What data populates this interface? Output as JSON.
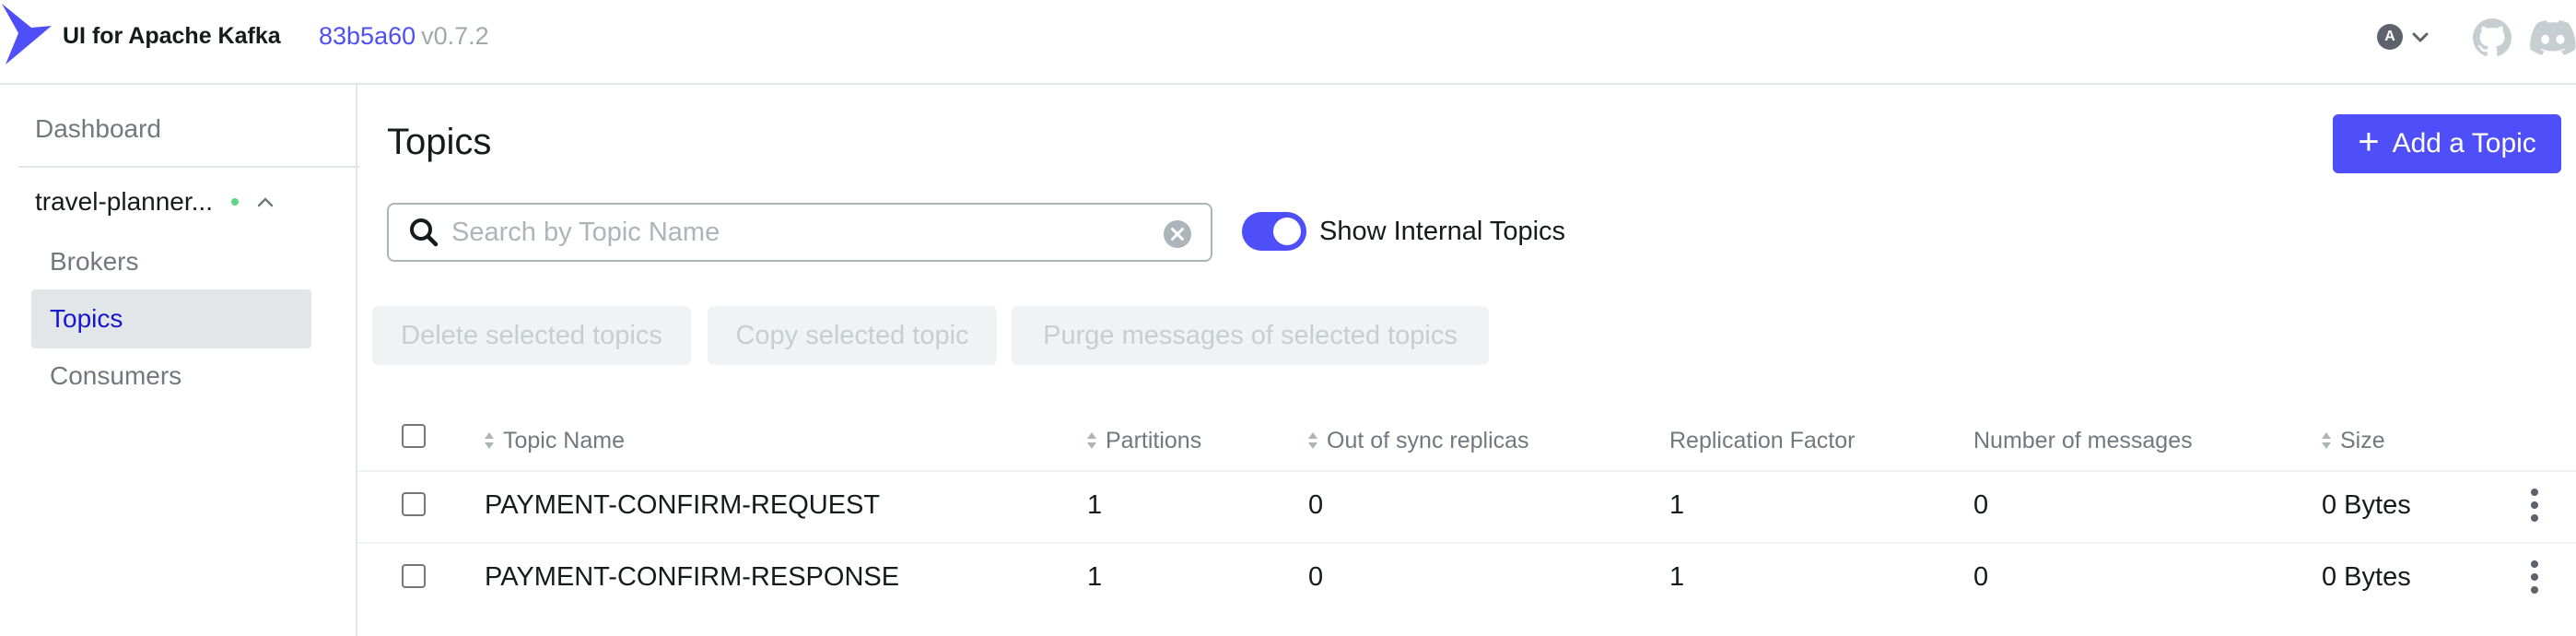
{
  "header": {
    "app_title": "UI for Apache Kafka",
    "version_hash": "83b5a60",
    "version_tag": "v0.7.2",
    "user_initial": "A"
  },
  "sidebar": {
    "dashboard": "Dashboard",
    "cluster_name": "travel-planner...",
    "items": [
      {
        "label": "Brokers",
        "active": false
      },
      {
        "label": "Topics",
        "active": true
      },
      {
        "label": "Consumers",
        "active": false
      }
    ]
  },
  "main": {
    "title": "Topics",
    "add_button": "Add a Topic",
    "search_placeholder": "Search by Topic Name",
    "toggle_label": "Show Internal Topics",
    "toggle_on": true,
    "batch_actions": [
      "Delete selected topics",
      "Copy selected topic",
      "Purge messages of selected topics"
    ]
  },
  "table": {
    "columns": [
      "Topic Name",
      "Partitions",
      "Out of sync replicas",
      "Replication Factor",
      "Number of messages",
      "Size"
    ],
    "rows": [
      {
        "name": "PAYMENT-CONFIRM-REQUEST",
        "partitions": "1",
        "out_of_sync": "0",
        "replication": "1",
        "messages": "0",
        "size": "0 Bytes"
      },
      {
        "name": "PAYMENT-CONFIRM-RESPONSE",
        "partitions": "1",
        "out_of_sync": "0",
        "replication": "1",
        "messages": "0",
        "size": "0 Bytes"
      }
    ]
  },
  "colors": {
    "accent": "#4f4ffa",
    "active_nav_text": "#1717cf",
    "muted_text": "#73787e",
    "status_online": "#5cd685"
  },
  "icons": [
    "kafka-logo-icon",
    "chevron-down-icon",
    "github-icon",
    "discord-icon",
    "chevron-up-icon",
    "search-icon",
    "clear-icon",
    "sort-icon",
    "kebab-menu-icon",
    "plus-icon"
  ]
}
